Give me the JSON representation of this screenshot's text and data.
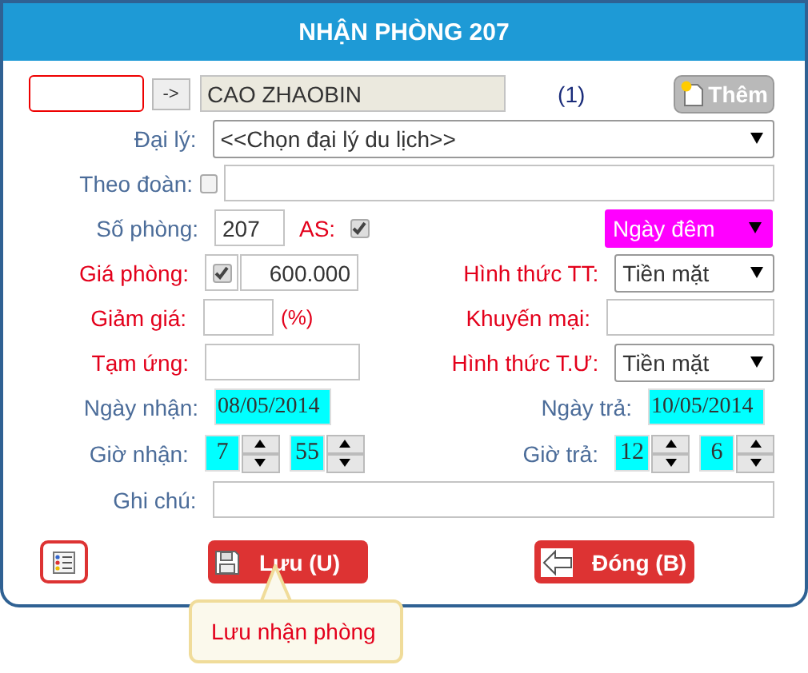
{
  "dialog": {
    "title": "NHẬN PHÒNG 207"
  },
  "guest": {
    "lookup_button": "->",
    "name": "CAO ZHAOBIN",
    "count": "(1)",
    "add_button": "Thêm"
  },
  "agency": {
    "label": "Đại lý:",
    "emphasis": false,
    "value": "<<Chọn đại lý du lịch>>"
  },
  "group": {
    "label": "Theo đoàn:",
    "emphasis": false,
    "checked": false
  },
  "room": {
    "label": "Số phòng:",
    "emphasis": false,
    "value": "207",
    "as_label": "AS:",
    "as_checked": true,
    "rate_type": "Ngày đêm"
  },
  "price": {
    "label": "Giá phòng:",
    "emphasis": true,
    "checked": true,
    "value": "600.000"
  },
  "payment": {
    "label": "Hình thức TT:",
    "emphasis": true,
    "value": "Tiền mặt"
  },
  "discount": {
    "label": "Giảm giá:",
    "emphasis": true,
    "unit": "(%)"
  },
  "promotion": {
    "label": "Khuyến mại:",
    "emphasis": true
  },
  "advance": {
    "label": "Tạm ứng:",
    "emphasis": true
  },
  "advance_method": {
    "label": "Hình thức T.Ư:",
    "emphasis": true,
    "value": "Tiền mặt"
  },
  "checkin_date": {
    "label": "Ngày nhận:",
    "emphasis": false,
    "value": "08/05/2014"
  },
  "checkout_date": {
    "label": "Ngày trả:",
    "emphasis": false,
    "value": "10/05/2014"
  },
  "checkin_time": {
    "label": "Giờ nhận:",
    "emphasis": false,
    "hour": "7",
    "minute": "55"
  },
  "checkout_time": {
    "label": "Giờ trả:",
    "emphasis": false,
    "hour": "12",
    "minute": "6"
  },
  "note": {
    "label": "Ghi chú:",
    "emphasis": false
  },
  "buttons": [
    {
      "kind": "save",
      "label": "Lưu (U)"
    },
    {
      "kind": "close",
      "label": "Đóng (B)"
    }
  ],
  "tooltip": {
    "text": "Lưu nhận phòng"
  }
}
